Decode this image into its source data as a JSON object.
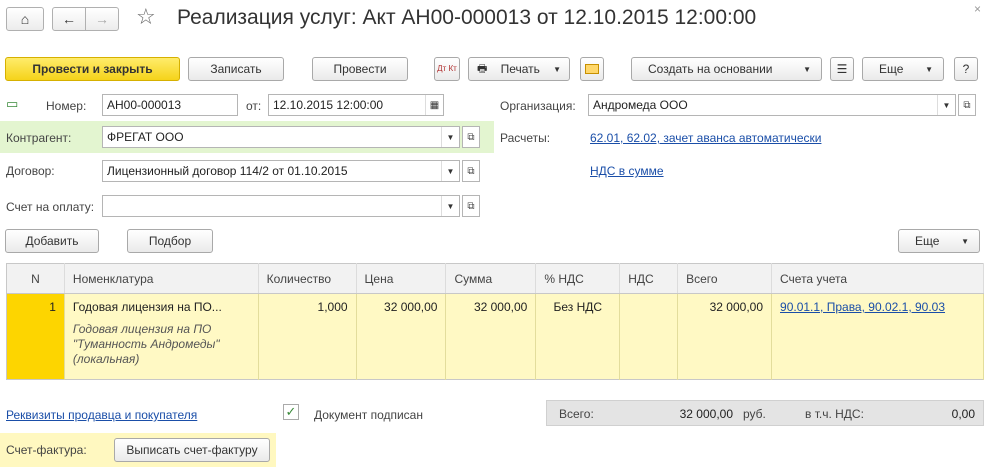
{
  "window": {
    "title": "Реализация услуг: Акт АН00-000013 от 12.10.2015 12:00:00"
  },
  "toolbar": {
    "post_close": "Провести и закрыть",
    "save": "Записать",
    "post": "Провести",
    "dtkt": "Дт Кт",
    "print": "Печать",
    "create_based": "Создать на основании",
    "more": "Еще",
    "help": "?"
  },
  "form": {
    "number_label": "Номер:",
    "number_value": "АН00-000013",
    "date_label": "от:",
    "date_value": "12.10.2015 12:00:00",
    "org_label": "Организация:",
    "org_value": "Андромеда ООО",
    "contractor_label": "Контрагент:",
    "contractor_value": "ФРЕГАТ ООО",
    "settlements_label": "Расчеты:",
    "settlements_link": "62.01, 62.02, зачет аванса автоматически",
    "contract_label": "Договор:",
    "contract_value": "Лицензионный договор 114/2 от 01.10.2015",
    "vat_link": "НДС в сумме",
    "invoice_label": "Счет на оплату:",
    "invoice_value": ""
  },
  "table_toolbar": {
    "add": "Добавить",
    "select": "Подбор",
    "more": "Еще"
  },
  "table": {
    "columns": [
      "N",
      "Номенклатура",
      "Количество",
      "Цена",
      "Сумма",
      "% НДС",
      "НДС",
      "Всего",
      "Счета учета"
    ],
    "rows": [
      {
        "n": "1",
        "item": "Годовая лицензия на ПО...",
        "item_desc": "Годовая лицензия на ПО \"Туманность Андромеды\" (локальная)",
        "qty": "1,000",
        "price": "32 000,00",
        "sum": "32 000,00",
        "vat_rate": "Без НДС",
        "vat": "",
        "total": "32 000,00",
        "accounts": "90.01.1, Права, 90.02.1, 90.03"
      }
    ]
  },
  "footer": {
    "requisites_link": "Реквизиты продавца и покупателя",
    "signed_label": "Документ подписан",
    "signed": true,
    "total_label": "Всего:",
    "total_value": "32 000,00",
    "currency": "руб.",
    "vat_label": "в т.ч. НДС:",
    "vat_value": "0,00",
    "invoice_label": "Счет-фактура:",
    "invoice_button": "Выписать счет-фактуру"
  }
}
